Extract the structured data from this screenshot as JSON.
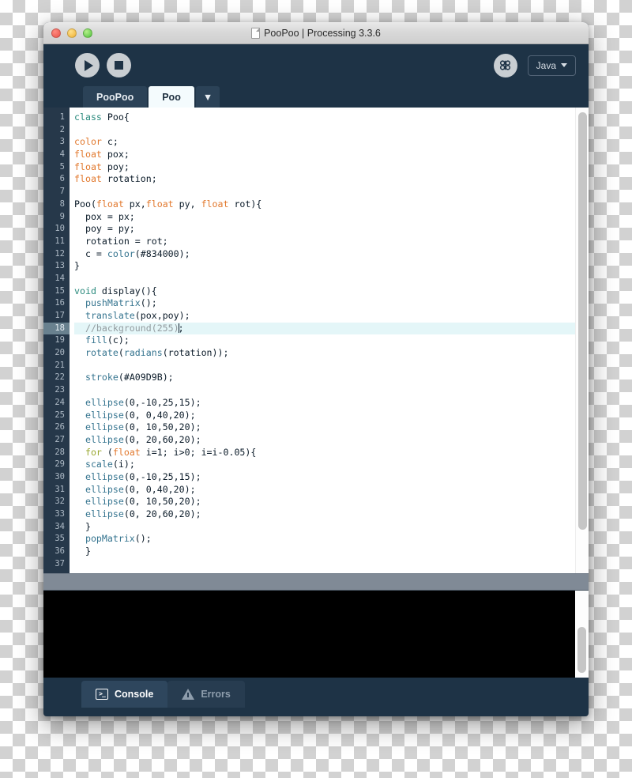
{
  "window": {
    "title": "PooPoo | Processing 3.3.6",
    "doc_icon": "document-icon",
    "traffic_lights": [
      "close",
      "minimize",
      "zoom"
    ]
  },
  "toolbar": {
    "run_label": "Run",
    "stop_label": "Stop",
    "debug_label": "Debugger",
    "mode_label": "Java",
    "colors": {
      "chrome": "#1e3346",
      "button_fill": "#c9ced2",
      "text": "#d6dde4"
    }
  },
  "tabs": [
    {
      "label": "PooPoo",
      "active": false
    },
    {
      "label": "Poo",
      "active": true
    }
  ],
  "tab_dropdown": "▼",
  "editor": {
    "current_line": 18,
    "total_lines": 37,
    "colors": {
      "background": "#ffffff",
      "gutter": "#26384a",
      "gutter_text": "#aebac6",
      "current_line_highlight": "#e4f6f8",
      "keyword_orange": "#e2792e",
      "keyword_teal": "#2a8a7d",
      "keyword_green": "#9aa832",
      "function_blue": "#35748f",
      "comment_gray": "#929b9f",
      "plain_text": "#0a1a28"
    },
    "lines": [
      {
        "n": 1,
        "tokens": [
          {
            "t": "class",
            "c": "teal"
          },
          {
            "t": " Poo{",
            "c": "plain"
          }
        ]
      },
      {
        "n": 2,
        "tokens": []
      },
      {
        "n": 3,
        "tokens": [
          {
            "t": "color",
            "c": "orange"
          },
          {
            "t": " c;",
            "c": "plain"
          }
        ]
      },
      {
        "n": 4,
        "tokens": [
          {
            "t": "float",
            "c": "orange"
          },
          {
            "t": " pox;",
            "c": "plain"
          }
        ]
      },
      {
        "n": 5,
        "tokens": [
          {
            "t": "float",
            "c": "orange"
          },
          {
            "t": " poy;",
            "c": "plain"
          }
        ]
      },
      {
        "n": 6,
        "tokens": [
          {
            "t": "float",
            "c": "orange"
          },
          {
            "t": " rotation;",
            "c": "plain"
          }
        ]
      },
      {
        "n": 7,
        "tokens": []
      },
      {
        "n": 8,
        "tokens": [
          {
            "t": "Poo(",
            "c": "plain"
          },
          {
            "t": "float",
            "c": "orange"
          },
          {
            "t": " px,",
            "c": "plain"
          },
          {
            "t": "float",
            "c": "orange"
          },
          {
            "t": " py, ",
            "c": "plain"
          },
          {
            "t": "float",
            "c": "orange"
          },
          {
            "t": " rot){",
            "c": "plain"
          }
        ]
      },
      {
        "n": 9,
        "tokens": [
          {
            "t": "  pox = px;",
            "c": "plain"
          }
        ]
      },
      {
        "n": 10,
        "tokens": [
          {
            "t": "  poy = py;",
            "c": "plain"
          }
        ]
      },
      {
        "n": 11,
        "tokens": [
          {
            "t": "  rotation = rot;",
            "c": "plain"
          }
        ]
      },
      {
        "n": 12,
        "tokens": [
          {
            "t": "  c = ",
            "c": "plain"
          },
          {
            "t": "color",
            "c": "fn"
          },
          {
            "t": "(#834000);",
            "c": "plain"
          }
        ]
      },
      {
        "n": 13,
        "tokens": [
          {
            "t": "}",
            "c": "plain"
          }
        ]
      },
      {
        "n": 14,
        "tokens": []
      },
      {
        "n": 15,
        "tokens": [
          {
            "t": "void",
            "c": "teal"
          },
          {
            "t": " display(){",
            "c": "plain"
          }
        ]
      },
      {
        "n": 16,
        "tokens": [
          {
            "t": "  ",
            "c": "plain"
          },
          {
            "t": "pushMatrix",
            "c": "fn"
          },
          {
            "t": "();",
            "c": "plain"
          }
        ]
      },
      {
        "n": 17,
        "tokens": [
          {
            "t": "  ",
            "c": "plain"
          },
          {
            "t": "translate",
            "c": "fn"
          },
          {
            "t": "(pox,poy);",
            "c": "plain"
          }
        ]
      },
      {
        "n": 18,
        "tokens": [
          {
            "t": "  //background(255)",
            "c": "comment"
          }
        ],
        "cursor": true,
        "trailing": ";"
      },
      {
        "n": 19,
        "tokens": [
          {
            "t": "  ",
            "c": "plain"
          },
          {
            "t": "fill",
            "c": "fn"
          },
          {
            "t": "(c);",
            "c": "plain"
          }
        ]
      },
      {
        "n": 20,
        "tokens": [
          {
            "t": "  ",
            "c": "plain"
          },
          {
            "t": "rotate",
            "c": "fn"
          },
          {
            "t": "(",
            "c": "plain"
          },
          {
            "t": "radians",
            "c": "fn"
          },
          {
            "t": "(rotation));",
            "c": "plain"
          }
        ]
      },
      {
        "n": 21,
        "tokens": []
      },
      {
        "n": 22,
        "tokens": [
          {
            "t": "  ",
            "c": "plain"
          },
          {
            "t": "stroke",
            "c": "fn"
          },
          {
            "t": "(#A09D9B);",
            "c": "plain"
          }
        ]
      },
      {
        "n": 23,
        "tokens": []
      },
      {
        "n": 24,
        "tokens": [
          {
            "t": "  ",
            "c": "plain"
          },
          {
            "t": "ellipse",
            "c": "fn"
          },
          {
            "t": "(0,-10,25,15);",
            "c": "plain"
          }
        ]
      },
      {
        "n": 25,
        "tokens": [
          {
            "t": "  ",
            "c": "plain"
          },
          {
            "t": "ellipse",
            "c": "fn"
          },
          {
            "t": "(0, 0,40,20);",
            "c": "plain"
          }
        ]
      },
      {
        "n": 26,
        "tokens": [
          {
            "t": "  ",
            "c": "plain"
          },
          {
            "t": "ellipse",
            "c": "fn"
          },
          {
            "t": "(0, 10,50,20);",
            "c": "plain"
          }
        ]
      },
      {
        "n": 27,
        "tokens": [
          {
            "t": "  ",
            "c": "plain"
          },
          {
            "t": "ellipse",
            "c": "fn"
          },
          {
            "t": "(0, 20,60,20);",
            "c": "plain"
          }
        ]
      },
      {
        "n": 28,
        "tokens": [
          {
            "t": "  ",
            "c": "plain"
          },
          {
            "t": "for",
            "c": "green"
          },
          {
            "t": " (",
            "c": "plain"
          },
          {
            "t": "float",
            "c": "orange"
          },
          {
            "t": " i=1; i>0; i=i-0.05){",
            "c": "plain"
          }
        ]
      },
      {
        "n": 29,
        "tokens": [
          {
            "t": "  ",
            "c": "plain"
          },
          {
            "t": "scale",
            "c": "fn"
          },
          {
            "t": "(i);",
            "c": "plain"
          }
        ]
      },
      {
        "n": 30,
        "tokens": [
          {
            "t": "  ",
            "c": "plain"
          },
          {
            "t": "ellipse",
            "c": "fn"
          },
          {
            "t": "(0,-10,25,15);",
            "c": "plain"
          }
        ]
      },
      {
        "n": 31,
        "tokens": [
          {
            "t": "  ",
            "c": "plain"
          },
          {
            "t": "ellipse",
            "c": "fn"
          },
          {
            "t": "(0, 0,40,20);",
            "c": "plain"
          }
        ]
      },
      {
        "n": 32,
        "tokens": [
          {
            "t": "  ",
            "c": "plain"
          },
          {
            "t": "ellipse",
            "c": "fn"
          },
          {
            "t": "(0, 10,50,20);",
            "c": "plain"
          }
        ]
      },
      {
        "n": 33,
        "tokens": [
          {
            "t": "  ",
            "c": "plain"
          },
          {
            "t": "ellipse",
            "c": "fn"
          },
          {
            "t": "(0, 20,60,20);",
            "c": "plain"
          }
        ]
      },
      {
        "n": 34,
        "tokens": [
          {
            "t": "  }",
            "c": "plain"
          }
        ]
      },
      {
        "n": 35,
        "tokens": [
          {
            "t": "  ",
            "c": "plain"
          },
          {
            "t": "popMatrix",
            "c": "fn"
          },
          {
            "t": "();",
            "c": "plain"
          }
        ]
      },
      {
        "n": 36,
        "tokens": [
          {
            "t": "  }",
            "c": "plain"
          }
        ]
      },
      {
        "n": 37,
        "tokens": []
      }
    ]
  },
  "console": {
    "output": "",
    "background": "#000000"
  },
  "bottom_tabs": [
    {
      "label": "Console",
      "icon": "terminal-icon",
      "active": true
    },
    {
      "label": "Errors",
      "icon": "warning-triangle-icon",
      "active": false
    }
  ]
}
